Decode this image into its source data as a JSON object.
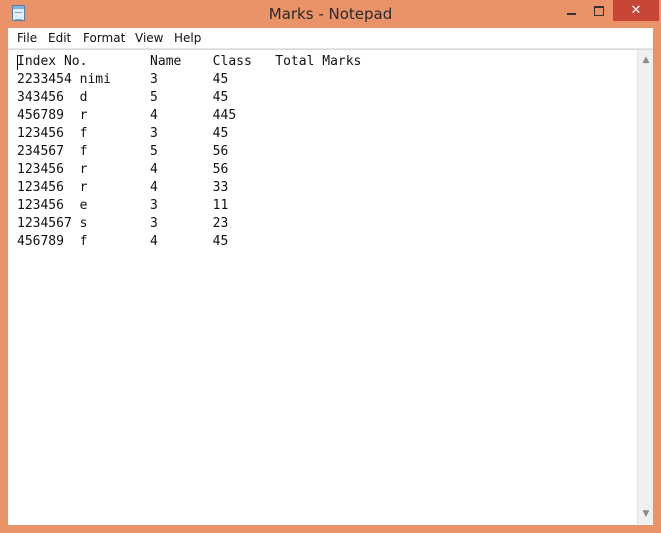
{
  "window": {
    "title": "Marks - Notepad",
    "accent_color": "#ea9268",
    "close_color": "#c74637",
    "app_icon": "notepad-icon",
    "controls": {
      "minimize_icon": "minimize-icon",
      "maximize_icon": "maximize-icon",
      "close_label": "✕"
    }
  },
  "menu": {
    "items": [
      "File",
      "Edit",
      "Format",
      "View",
      "Help"
    ]
  },
  "document": {
    "text": "Index No.        Name    Class   Total Marks\n2233454 nimi     3       45\n343456  d        5       45\n456789  r        4       445\n123456  f        3       45\n234567  f        5       56\n123456  r        4       56\n123456  r        4       33\n123456  e        3       11\n1234567 s        3       23\n456789  f        4       45"
  },
  "scrollbar": {
    "up_arrow": "▲",
    "down_arrow": "▼"
  }
}
